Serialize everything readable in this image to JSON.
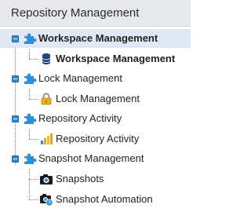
{
  "panel": {
    "title": "Repository Management"
  },
  "tree": {
    "workspace_management": {
      "label": "Workspace Management",
      "icon": "puzzle-icon",
      "child_label": "Workspace Management",
      "child_icon": "database-icon"
    },
    "lock_management": {
      "label": "Lock Management",
      "icon": "puzzle-icon",
      "child_label": "Lock Management",
      "child_icon": "lock-icon"
    },
    "repository_activity": {
      "label": "Repository Activity",
      "icon": "puzzle-icon",
      "child_label": "Repository Activity",
      "child_icon": "bar-chart-icon"
    },
    "snapshot_management": {
      "label": "Snapshot Management",
      "icon": "puzzle-icon",
      "children": [
        {
          "label": "Snapshots",
          "icon": "camera-icon"
        },
        {
          "label": "Snapshot Automation",
          "icon": "camera-clock-icon"
        }
      ]
    }
  },
  "colors": {
    "header_bg": "#e6e8ec",
    "selected_row_bg": "#dfe8f3",
    "toggle_blue": "#2b8ad0",
    "puzzle_blue": "#2f8fd8"
  }
}
